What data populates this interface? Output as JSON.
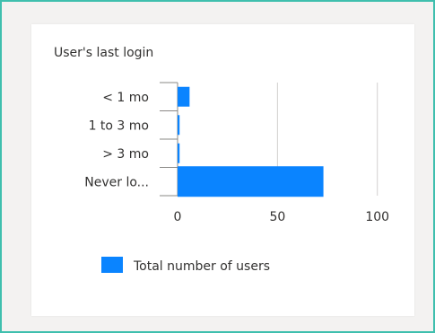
{
  "card": {
    "title": "User's last login"
  },
  "chart_data": {
    "type": "bar",
    "orientation": "horizontal",
    "title": "User's last login",
    "categories": [
      "< 1 mo",
      "1 to 3 mo",
      "> 3 mo",
      "Never lo..."
    ],
    "series": [
      {
        "name": "Total number of users",
        "values": [
          6,
          1,
          1,
          73
        ],
        "color": "#0a84ff"
      }
    ],
    "xlim": [
      0,
      110
    ],
    "xticks": [
      0,
      50,
      100
    ],
    "xtick_labels": [
      "0",
      "50",
      "100"
    ],
    "grid": "vertical",
    "legend": "bottom-center"
  },
  "colors": {
    "accent": "#0a84ff",
    "frame_border": "#3fbfae",
    "gridline": "#d2d0ce",
    "axis": "#8a8886"
  }
}
